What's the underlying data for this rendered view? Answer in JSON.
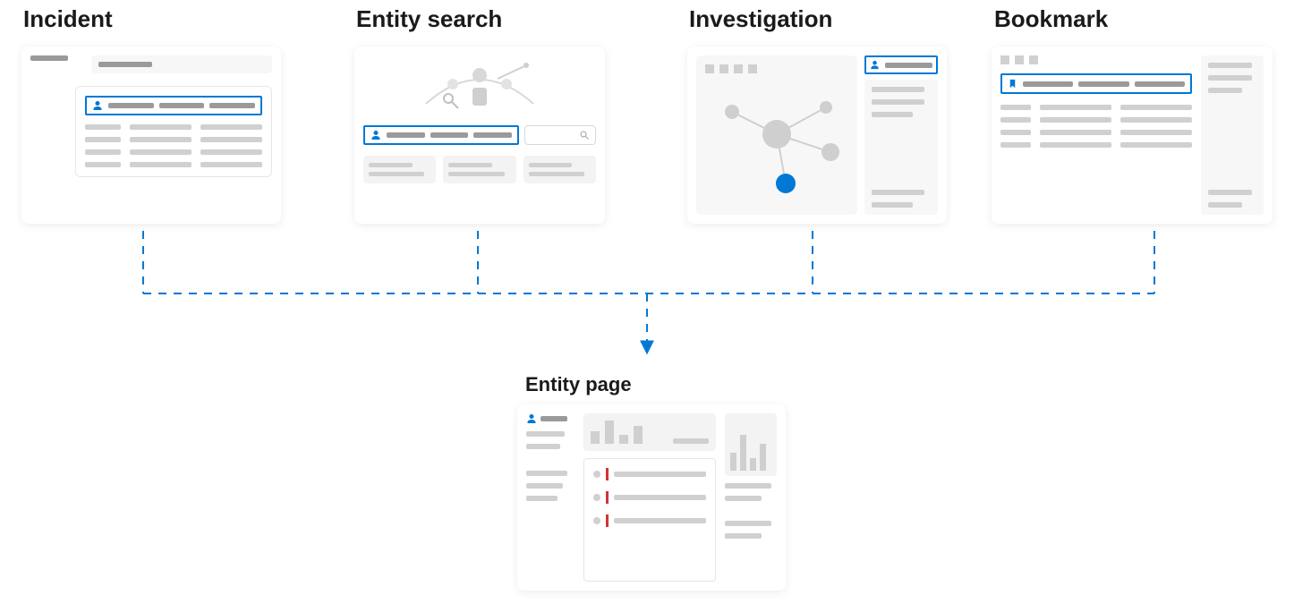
{
  "sources": {
    "incident": {
      "label": "Incident"
    },
    "entity_search": {
      "label": "Entity search"
    },
    "investigation": {
      "label": "Investigation"
    },
    "bookmark": {
      "label": "Bookmark"
    }
  },
  "target": {
    "label": "Entity page"
  },
  "colors": {
    "accent": "#0078d4",
    "placeholder": "#d0d0d0",
    "placeholder_dark": "#9a9a9a",
    "alert_red": "#d13438"
  },
  "icons": {
    "user": "user-icon",
    "bookmark": "bookmark-icon",
    "search": "search-icon"
  }
}
